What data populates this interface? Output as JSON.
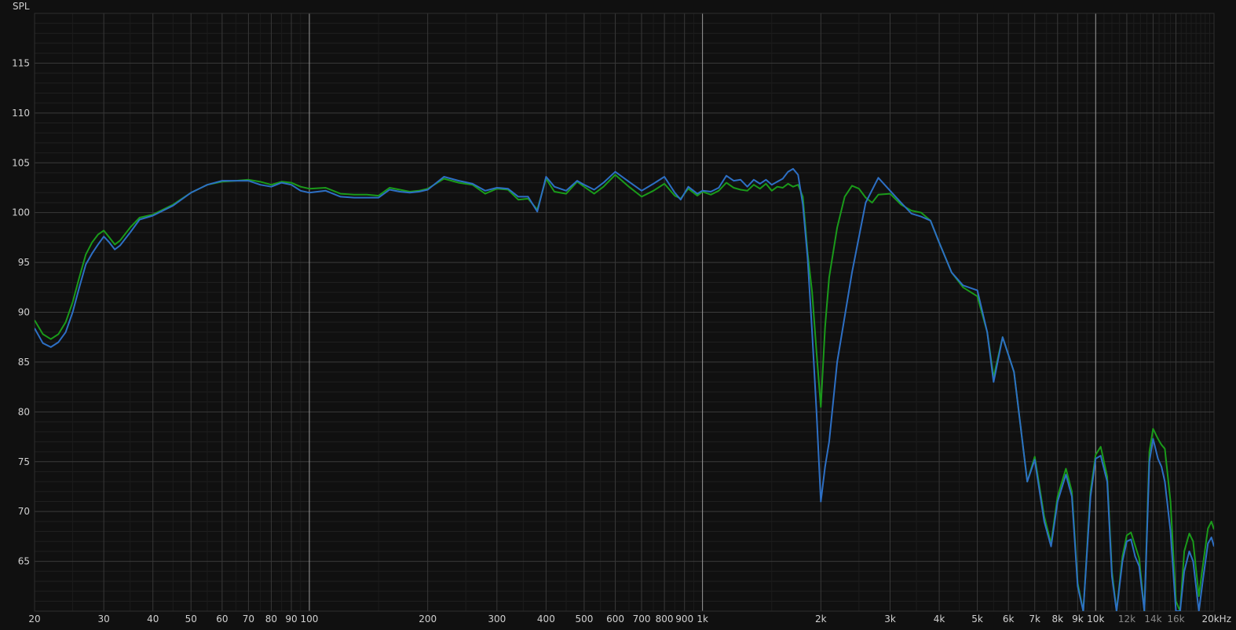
{
  "chart_data": {
    "type": "line",
    "ylabel": "SPL",
    "xscale": "log",
    "xlim": [
      20,
      20000
    ],
    "ylim": [
      60,
      120
    ],
    "grid": true,
    "y_ticks": [
      65,
      70,
      75,
      80,
      85,
      90,
      95,
      100,
      105,
      110,
      115
    ],
    "y_tick_labels": [
      "65",
      "70",
      "75",
      "80",
      "85",
      "90",
      "95",
      "100",
      "105",
      "110",
      "115"
    ],
    "x_tick_labels": [
      {
        "f": 20,
        "label": "20"
      },
      {
        "f": 30,
        "label": "30"
      },
      {
        "f": 40,
        "label": "40"
      },
      {
        "f": 50,
        "label": "50"
      },
      {
        "f": 60,
        "label": "60"
      },
      {
        "f": 70,
        "label": "70"
      },
      {
        "f": 80,
        "label": "80"
      },
      {
        "f": 90,
        "label": "90"
      },
      {
        "f": 100,
        "label": "100"
      },
      {
        "f": 200,
        "label": "200"
      },
      {
        "f": 300,
        "label": "300"
      },
      {
        "f": 400,
        "label": "400"
      },
      {
        "f": 500,
        "label": "500"
      },
      {
        "f": 600,
        "label": "600"
      },
      {
        "f": 700,
        "label": "700"
      },
      {
        "f": 800,
        "label": "800"
      },
      {
        "f": 900,
        "label": "900"
      },
      {
        "f": 1000,
        "label": "1k"
      },
      {
        "f": 2000,
        "label": "2k"
      },
      {
        "f": 3000,
        "label": "3k"
      },
      {
        "f": 4000,
        "label": "4k"
      },
      {
        "f": 5000,
        "label": "5k"
      },
      {
        "f": 6000,
        "label": "6k"
      },
      {
        "f": 7000,
        "label": "7k"
      },
      {
        "f": 8000,
        "label": "8k"
      },
      {
        "f": 9000,
        "label": "9k"
      },
      {
        "f": 10000,
        "label": "10k"
      },
      {
        "f": 12000,
        "label": "12k",
        "dim": true
      },
      {
        "f": 14000,
        "label": "14k",
        "dim": true
      },
      {
        "f": 16000,
        "label": "16k",
        "dim": true
      },
      {
        "f": 20000,
        "label": "20kHz"
      }
    ],
    "series": [
      {
        "color": "#1a9a1a",
        "points": [
          [
            20,
            89.2
          ],
          [
            21,
            87.8
          ],
          [
            22,
            87.3
          ],
          [
            23,
            87.8
          ],
          [
            24,
            89
          ],
          [
            25,
            91
          ],
          [
            26,
            93.5
          ],
          [
            27,
            95.8
          ],
          [
            28,
            97
          ],
          [
            29,
            97.8
          ],
          [
            30,
            98.2
          ],
          [
            31,
            97.5
          ],
          [
            32,
            96.8
          ],
          [
            33,
            97.2
          ],
          [
            35,
            98.5
          ],
          [
            37,
            99.5
          ],
          [
            40,
            99.8
          ],
          [
            45,
            100.8
          ],
          [
            50,
            102
          ],
          [
            55,
            102.8
          ],
          [
            60,
            103.1
          ],
          [
            65,
            103.2
          ],
          [
            70,
            103.3
          ],
          [
            75,
            103.1
          ],
          [
            80,
            102.8
          ],
          [
            85,
            103.1
          ],
          [
            90,
            103
          ],
          [
            95,
            102.6
          ],
          [
            100,
            102.4
          ],
          [
            110,
            102.5
          ],
          [
            120,
            101.9
          ],
          [
            130,
            101.8
          ],
          [
            140,
            101.8
          ],
          [
            150,
            101.7
          ],
          [
            160,
            102.5
          ],
          [
            170,
            102.3
          ],
          [
            180,
            102.1
          ],
          [
            190,
            102.2
          ],
          [
            200,
            102.4
          ],
          [
            220,
            103.4
          ],
          [
            240,
            103
          ],
          [
            260,
            102.8
          ],
          [
            280,
            101.9
          ],
          [
            300,
            102.4
          ],
          [
            320,
            102.3
          ],
          [
            340,
            101.3
          ],
          [
            360,
            101.4
          ],
          [
            380,
            100.3
          ],
          [
            400,
            103.4
          ],
          [
            420,
            102.1
          ],
          [
            450,
            101.9
          ],
          [
            480,
            103.1
          ],
          [
            500,
            102.6
          ],
          [
            530,
            101.9
          ],
          [
            560,
            102.6
          ],
          [
            600,
            103.8
          ],
          [
            650,
            102.6
          ],
          [
            700,
            101.6
          ],
          [
            750,
            102.2
          ],
          [
            800,
            102.9
          ],
          [
            850,
            101.7
          ],
          [
            880,
            101.4
          ],
          [
            920,
            102.4
          ],
          [
            970,
            101.7
          ],
          [
            1000,
            102.1
          ],
          [
            1050,
            101.8
          ],
          [
            1100,
            102.2
          ],
          [
            1150,
            103
          ],
          [
            1200,
            102.5
          ],
          [
            1250,
            102.3
          ],
          [
            1300,
            102.2
          ],
          [
            1350,
            102.8
          ],
          [
            1400,
            102.4
          ],
          [
            1450,
            102.9
          ],
          [
            1500,
            102.2
          ],
          [
            1550,
            102.6
          ],
          [
            1600,
            102.5
          ],
          [
            1650,
            102.9
          ],
          [
            1700,
            102.6
          ],
          [
            1750,
            102.8
          ],
          [
            1800,
            101.6
          ],
          [
            1850,
            96
          ],
          [
            1900,
            92
          ],
          [
            1950,
            86
          ],
          [
            2000,
            80.5
          ],
          [
            2050,
            88.5
          ],
          [
            2100,
            93.5
          ],
          [
            2200,
            98.5
          ],
          [
            2300,
            101.6
          ],
          [
            2400,
            102.7
          ],
          [
            2500,
            102.4
          ],
          [
            2600,
            101.5
          ],
          [
            2700,
            101
          ],
          [
            2800,
            101.8
          ],
          [
            3000,
            101.9
          ],
          [
            3200,
            100.8
          ],
          [
            3400,
            100.2
          ],
          [
            3600,
            100
          ],
          [
            3800,
            99.2
          ],
          [
            4000,
            97
          ],
          [
            4300,
            94
          ],
          [
            4600,
            92.5
          ],
          [
            5000,
            91.6
          ],
          [
            5300,
            88
          ],
          [
            5500,
            83.5
          ],
          [
            5800,
            87.5
          ],
          [
            6200,
            84
          ],
          [
            6700,
            73
          ],
          [
            7000,
            75.5
          ],
          [
            7400,
            69.5
          ],
          [
            7700,
            66.8
          ],
          [
            8000,
            71.5
          ],
          [
            8400,
            74.3
          ],
          [
            8700,
            72
          ],
          [
            9000,
            62.8
          ],
          [
            9300,
            60
          ],
          [
            9700,
            72
          ],
          [
            10000,
            75.7
          ],
          [
            10300,
            76.5
          ],
          [
            10700,
            73.5
          ],
          [
            11000,
            64
          ],
          [
            11300,
            60
          ],
          [
            11700,
            65.5
          ],
          [
            12000,
            67.6
          ],
          [
            12300,
            67.9
          ],
          [
            12600,
            66.6
          ],
          [
            12900,
            65.3
          ],
          [
            13300,
            60
          ],
          [
            13700,
            76
          ],
          [
            14000,
            78.3
          ],
          [
            14400,
            77.3
          ],
          [
            14700,
            76.7
          ],
          [
            15000,
            76.3
          ],
          [
            15500,
            71
          ],
          [
            16000,
            61
          ],
          [
            16400,
            60
          ],
          [
            16800,
            66
          ],
          [
            17300,
            67.8
          ],
          [
            17700,
            67
          ],
          [
            18300,
            61.5
          ],
          [
            18800,
            65
          ],
          [
            19300,
            68.3
          ],
          [
            19700,
            69
          ],
          [
            20000,
            68.2
          ]
        ]
      },
      {
        "color": "#2d6fc4",
        "points": [
          [
            20,
            88.4
          ],
          [
            21,
            86.9
          ],
          [
            22,
            86.5
          ],
          [
            23,
            87
          ],
          [
            24,
            88
          ],
          [
            25,
            90
          ],
          [
            26,
            92.5
          ],
          [
            27,
            94.8
          ],
          [
            28,
            95.9
          ],
          [
            29,
            96.8
          ],
          [
            30,
            97.6
          ],
          [
            31,
            97
          ],
          [
            32,
            96.3
          ],
          [
            33,
            96.7
          ],
          [
            35,
            98
          ],
          [
            37,
            99.3
          ],
          [
            40,
            99.7
          ],
          [
            45,
            100.7
          ],
          [
            50,
            102
          ],
          [
            55,
            102.8
          ],
          [
            60,
            103.2
          ],
          [
            65,
            103.2
          ],
          [
            70,
            103.2
          ],
          [
            75,
            102.8
          ],
          [
            80,
            102.6
          ],
          [
            85,
            103
          ],
          [
            90,
            102.8
          ],
          [
            95,
            102.2
          ],
          [
            100,
            102
          ],
          [
            110,
            102.2
          ],
          [
            120,
            101.6
          ],
          [
            130,
            101.5
          ],
          [
            140,
            101.5
          ],
          [
            150,
            101.5
          ],
          [
            160,
            102.3
          ],
          [
            170,
            102.1
          ],
          [
            180,
            102
          ],
          [
            190,
            102.1
          ],
          [
            200,
            102.3
          ],
          [
            220,
            103.6
          ],
          [
            240,
            103.2
          ],
          [
            260,
            102.9
          ],
          [
            280,
            102.2
          ],
          [
            300,
            102.5
          ],
          [
            320,
            102.4
          ],
          [
            340,
            101.6
          ],
          [
            360,
            101.6
          ],
          [
            380,
            100.1
          ],
          [
            400,
            103.6
          ],
          [
            420,
            102.6
          ],
          [
            450,
            102.2
          ],
          [
            480,
            103.2
          ],
          [
            500,
            102.8
          ],
          [
            530,
            102.3
          ],
          [
            560,
            103
          ],
          [
            600,
            104.1
          ],
          [
            650,
            103.1
          ],
          [
            700,
            102.2
          ],
          [
            750,
            102.9
          ],
          [
            800,
            103.6
          ],
          [
            850,
            102
          ],
          [
            880,
            101.3
          ],
          [
            920,
            102.6
          ],
          [
            970,
            101.9
          ],
          [
            1000,
            102.2
          ],
          [
            1050,
            102.1
          ],
          [
            1100,
            102.5
          ],
          [
            1150,
            103.7
          ],
          [
            1200,
            103.2
          ],
          [
            1250,
            103.3
          ],
          [
            1300,
            102.6
          ],
          [
            1350,
            103.3
          ],
          [
            1400,
            102.9
          ],
          [
            1450,
            103.3
          ],
          [
            1500,
            102.8
          ],
          [
            1550,
            103.1
          ],
          [
            1600,
            103.4
          ],
          [
            1650,
            104.1
          ],
          [
            1700,
            104.4
          ],
          [
            1750,
            103.8
          ],
          [
            1800,
            100.8
          ],
          [
            1850,
            95.5
          ],
          [
            1900,
            88
          ],
          [
            1950,
            80
          ],
          [
            2000,
            71
          ],
          [
            2050,
            74.5
          ],
          [
            2100,
            77
          ],
          [
            2200,
            85
          ],
          [
            2400,
            94
          ],
          [
            2600,
            101
          ],
          [
            2800,
            103.5
          ],
          [
            3000,
            102.2
          ],
          [
            3200,
            101
          ],
          [
            3400,
            99.9
          ],
          [
            3600,
            99.6
          ],
          [
            3800,
            99.2
          ],
          [
            4000,
            97
          ],
          [
            4300,
            94
          ],
          [
            4600,
            92.7
          ],
          [
            5000,
            92.2
          ],
          [
            5300,
            88
          ],
          [
            5500,
            83
          ],
          [
            5800,
            87.5
          ],
          [
            6200,
            84
          ],
          [
            6700,
            73
          ],
          [
            7000,
            75.2
          ],
          [
            7400,
            69
          ],
          [
            7700,
            66.5
          ],
          [
            8000,
            71
          ],
          [
            8400,
            73.7
          ],
          [
            8700,
            71.5
          ],
          [
            9000,
            62.5
          ],
          [
            9300,
            60
          ],
          [
            9700,
            71.5
          ],
          [
            10000,
            75.3
          ],
          [
            10300,
            75.6
          ],
          [
            10700,
            73
          ],
          [
            11000,
            63.5
          ],
          [
            11300,
            60
          ],
          [
            11700,
            65
          ],
          [
            12000,
            67
          ],
          [
            12300,
            67.2
          ],
          [
            12600,
            65.5
          ],
          [
            12900,
            64.5
          ],
          [
            13300,
            60
          ],
          [
            13700,
            75
          ],
          [
            14000,
            77.3
          ],
          [
            14400,
            75.3
          ],
          [
            14700,
            74.5
          ],
          [
            15000,
            73
          ],
          [
            15500,
            68
          ],
          [
            16000,
            60
          ],
          [
            16400,
            60
          ],
          [
            16800,
            64
          ],
          [
            17300,
            66
          ],
          [
            17700,
            65
          ],
          [
            18300,
            60
          ],
          [
            18800,
            63.5
          ],
          [
            19300,
            66.8
          ],
          [
            19700,
            67.4
          ],
          [
            20000,
            66.5
          ]
        ]
      }
    ]
  }
}
